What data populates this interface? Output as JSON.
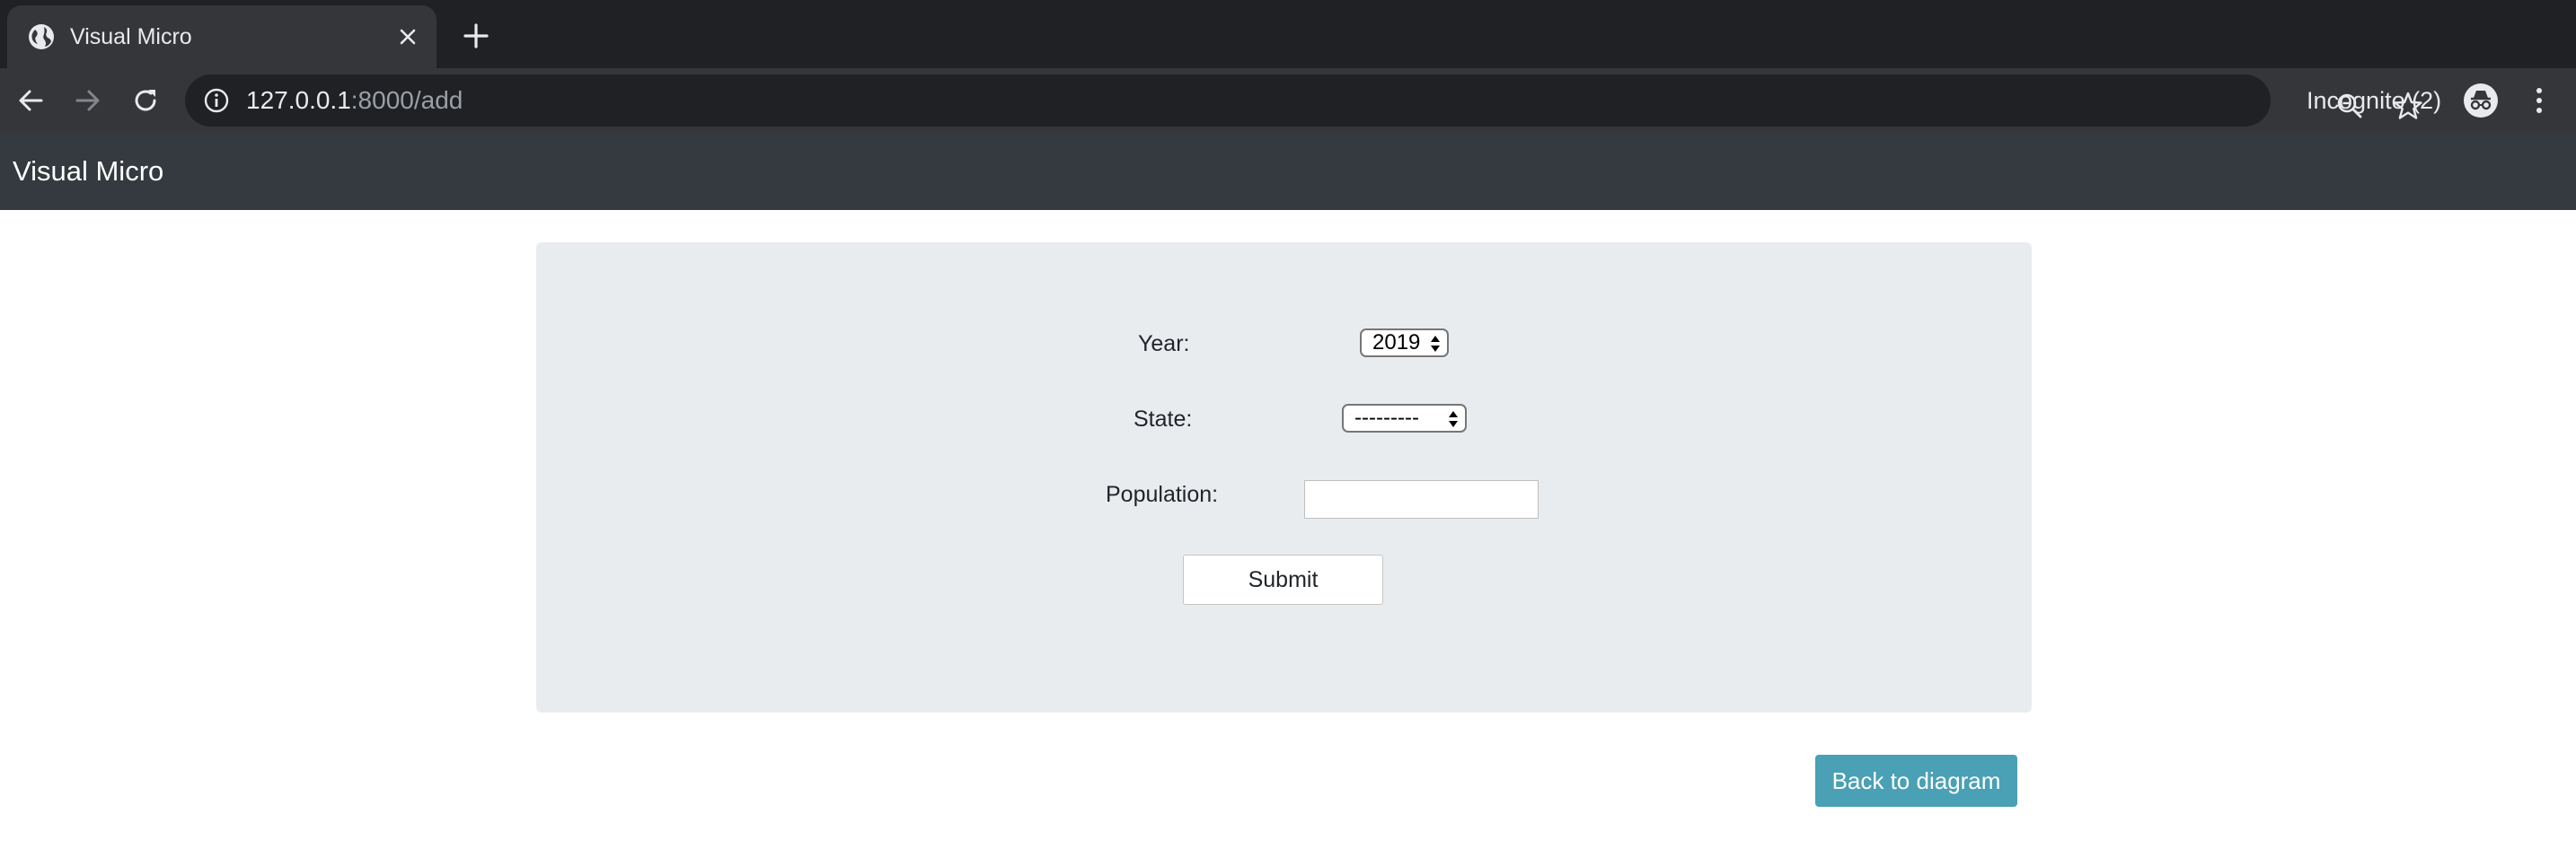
{
  "browser": {
    "tab": {
      "title": "Visual Micro",
      "favicon": "globe-icon",
      "close_icon": "close-icon"
    },
    "new_tab_icon": "plus-icon",
    "toolbar": {
      "back_icon": "arrow-left-icon",
      "forward_icon": "arrow-right-icon",
      "reload_icon": "reload-icon",
      "site_info_icon": "info-icon",
      "url_host": "127.0.0.1",
      "url_rest": ":8000/add",
      "zoom_icon": "zoom-out-icon",
      "bookmark_icon": "star-icon",
      "profile_label": "Incognito (2)",
      "profile_icon": "incognito-icon",
      "menu_icon": "kebab-menu-icon"
    },
    "colors": {
      "tabstrip": "#202124",
      "toolbar": "#35363a",
      "omnibox": "#202124"
    }
  },
  "navbar": {
    "brand": "Visual Micro",
    "background": "#343a40"
  },
  "form": {
    "year": {
      "label": "Year:",
      "selected": "2019"
    },
    "state": {
      "label": "State:",
      "selected": "---------"
    },
    "population": {
      "label": "Population:",
      "value": ""
    },
    "submit_label": "Submit",
    "panel_color": "#e9ecef"
  },
  "back_button": {
    "label": "Back to diagram",
    "color": "#4aa0b5"
  }
}
